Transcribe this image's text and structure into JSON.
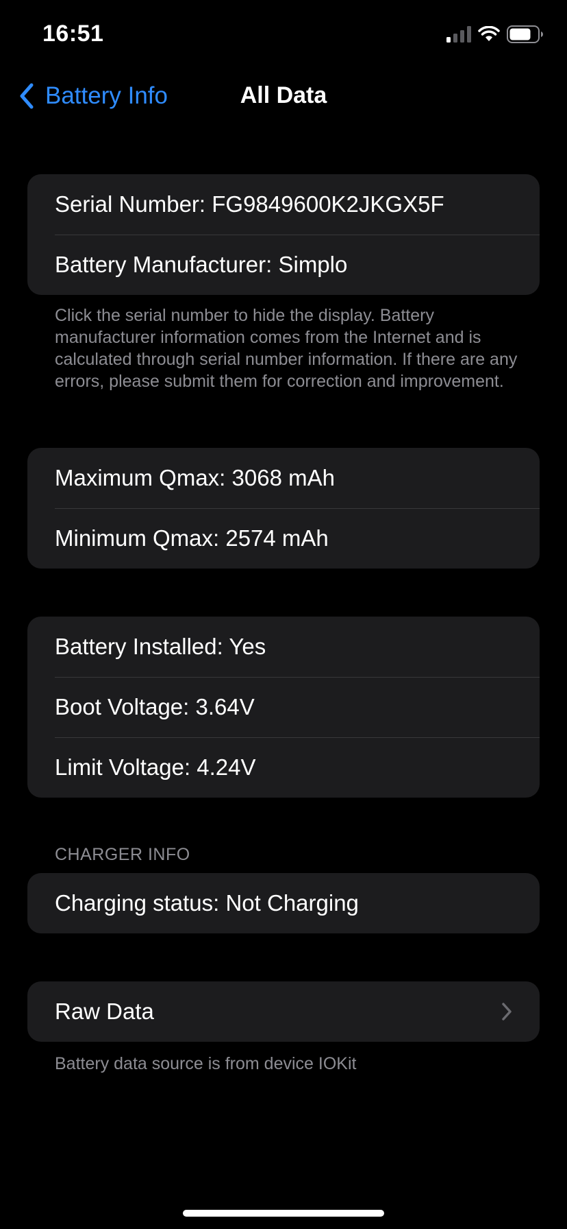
{
  "status_bar": {
    "time": "16:51"
  },
  "nav": {
    "back_label": "Battery Info",
    "title": "All Data"
  },
  "identity": {
    "serial": "Serial Number: FG9849600K2JKGX5F",
    "manufacturer": "Battery Manufacturer: Simplo",
    "footnote": "Click the serial number to hide the display. Battery manufacturer information comes from the Internet and is calculated through serial number information. If there are any errors, please submit them for correction and improvement."
  },
  "qmax": {
    "maximum": "Maximum Qmax: 3068 mAh",
    "minimum": "Minimum Qmax: 2574 mAh"
  },
  "battery": {
    "installed": "Battery Installed: Yes",
    "boot_voltage": "Boot Voltage: 3.64V",
    "limit_voltage": "Limit Voltage: 4.24V"
  },
  "charger": {
    "header": "CHARGER INFO",
    "status": "Charging status: Not Charging"
  },
  "raw_data": {
    "label": "Raw Data",
    "footnote": "Battery data source is from device IOKit"
  },
  "colors": {
    "background": "#000000",
    "cell": "#1c1c1e",
    "accent": "#2f8cff",
    "secondary_text": "#8d8d93"
  },
  "icons": [
    "cellular-signal-icon",
    "wifi-icon",
    "battery-icon",
    "chevron-left-icon",
    "chevron-right-icon"
  ]
}
